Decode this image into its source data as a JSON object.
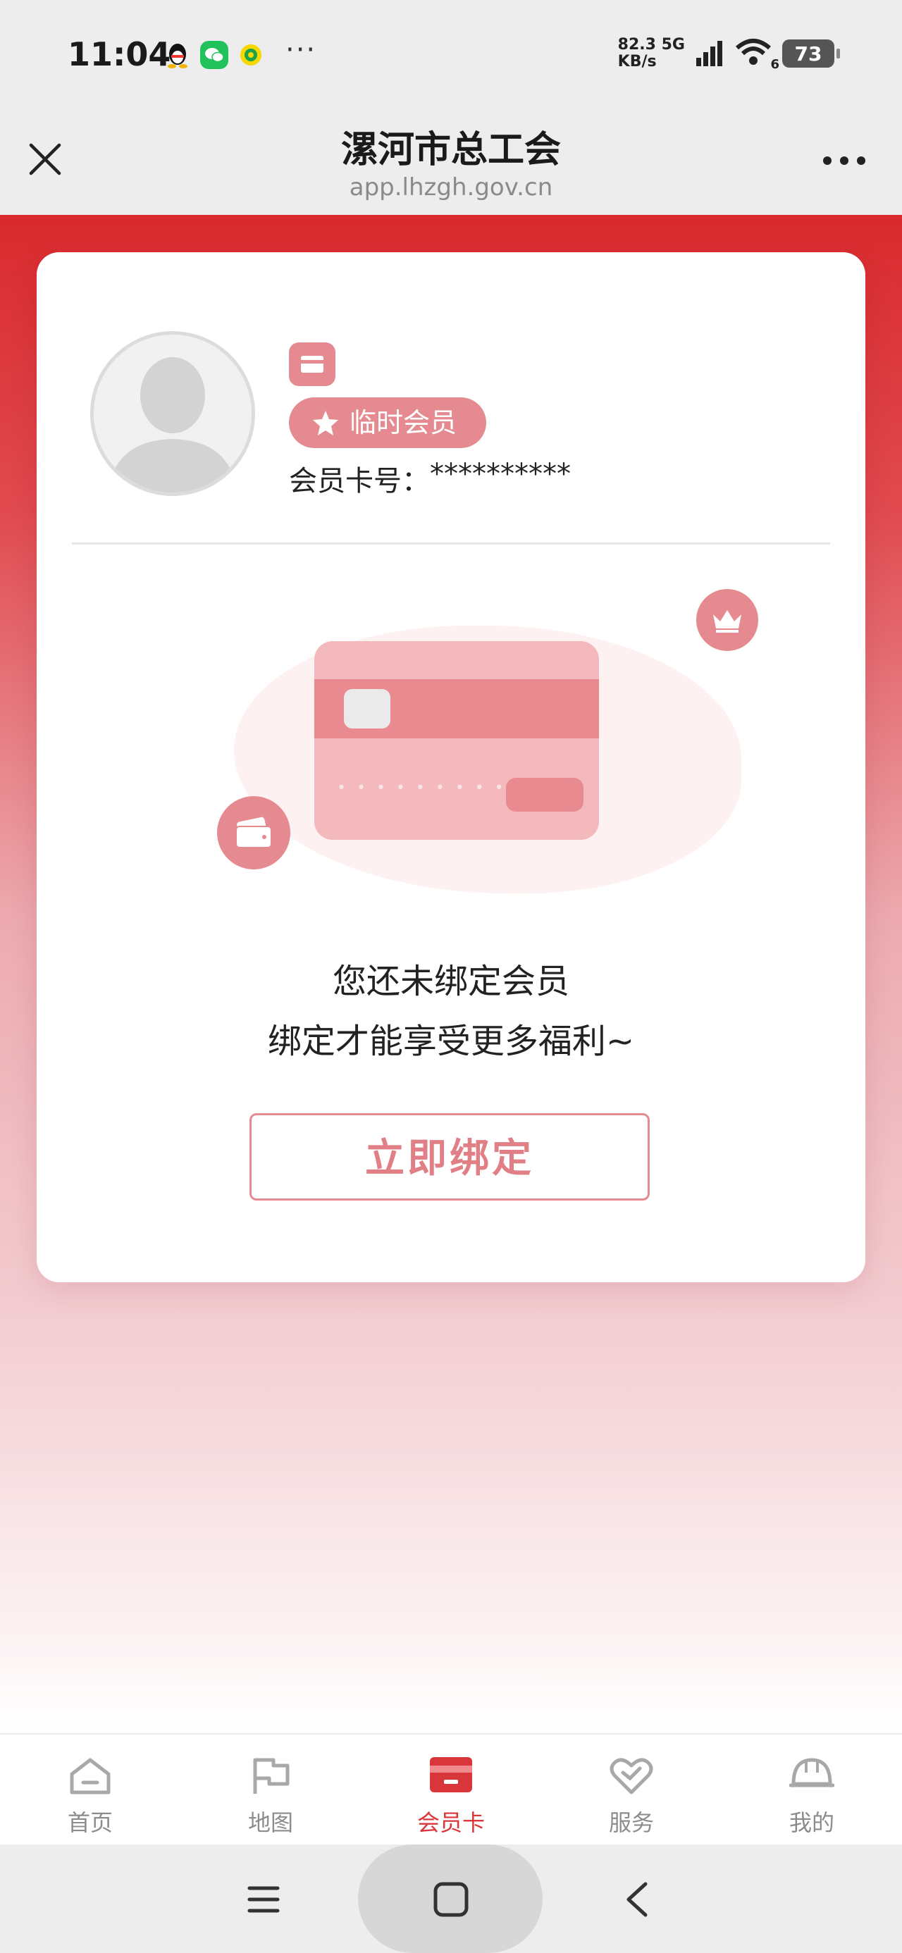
{
  "status_bar": {
    "time": "11:04",
    "more": "···",
    "net_speed_value": "82.3",
    "net_speed_unit": "KB/s",
    "network": "5G",
    "wifi_level": "6",
    "battery": "73"
  },
  "title_bar": {
    "title": "漯河市总工会",
    "url": "app.lhzgh.gov.cn"
  },
  "member": {
    "tag": "临时会员",
    "card_no_label": "会员卡号：",
    "card_no_value": "**********"
  },
  "prompt": {
    "line1": "您还未绑定会员",
    "line2": "绑定才能享受更多福利~"
  },
  "bind_button": "立即绑定",
  "bottom_nav": [
    {
      "label": "首页",
      "icon": "home-icon",
      "active": false
    },
    {
      "label": "地图",
      "icon": "map-flag-icon",
      "active": false
    },
    {
      "label": "会员卡",
      "icon": "member-card-icon",
      "active": true
    },
    {
      "label": "服务",
      "icon": "heart-service-icon",
      "active": false
    },
    {
      "label": "我的",
      "icon": "helmet-icon",
      "active": false
    }
  ],
  "colors": {
    "brand_red": "#d92a2e",
    "accent_pink": "#e58a90",
    "active_nav": "#d9363b"
  }
}
